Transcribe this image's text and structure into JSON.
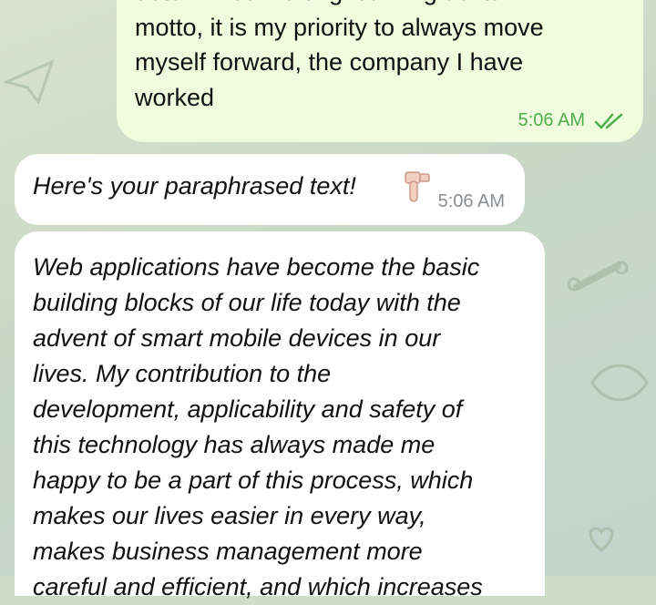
{
  "outgoing": {
    "lines": [
      "determined lifelong learning as its",
      "motto, it is my priority to always move",
      "myself forward, the company I have",
      "worked"
    ],
    "time": "5:06 AM",
    "status_icon": "double-check-icon"
  },
  "incoming_1": {
    "text": "Here's your paraphrased text!",
    "emoji": "pointing-down-hand-icon",
    "time": "5:06 AM"
  },
  "incoming_2": {
    "lines": [
      "Web applications have become the basic",
      "building blocks of our life today with the",
      "advent of smart mobile devices in our",
      "lives. My contribution to the",
      "development, applicability and safety of",
      "this technology has always made me",
      "happy to be a part of this process, which",
      "makes our lives easier in every way,",
      "makes business management more",
      "careful and efficient, and which increases"
    ]
  },
  "colors": {
    "outgoing_bubble": "#effdde",
    "incoming_bubble": "#ffffff",
    "outgoing_time": "#4fae4e",
    "incoming_time": "#8a8f93"
  }
}
